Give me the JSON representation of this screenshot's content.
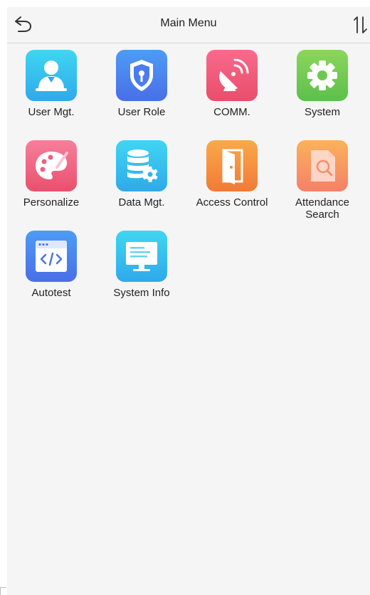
{
  "header": {
    "title": "Main Menu",
    "back_icon": "back-arrow-icon",
    "sort_icon": "sort-arrows-icon"
  },
  "menu": {
    "items": [
      {
        "id": "user-mgt",
        "label": "User Mgt.",
        "icon": "user-icon",
        "color_top": "#3fd6f2",
        "color_bottom": "#2fa9ea"
      },
      {
        "id": "user-role",
        "label": "User Role",
        "icon": "shield-key-icon",
        "color_top": "#4d9cf5",
        "color_bottom": "#4a6ee8"
      },
      {
        "id": "comm",
        "label": "COMM.",
        "icon": "satellite-dish-icon",
        "color_top": "#f86a8c",
        "color_bottom": "#ea4d6b"
      },
      {
        "id": "system",
        "label": "System",
        "icon": "gear-icon",
        "color_top": "#8bd65b",
        "color_bottom": "#5cc04c"
      },
      {
        "id": "personalize",
        "label": "Personalize",
        "icon": "palette-icon",
        "color_top": "#f77f9b",
        "color_bottom": "#e8506d"
      },
      {
        "id": "data-mgt",
        "label": "Data Mgt.",
        "icon": "database-gear-icon",
        "color_top": "#3fd6f2",
        "color_bottom": "#2fa9ea"
      },
      {
        "id": "access-control",
        "label": "Access Control",
        "icon": "door-icon",
        "color_top": "#f9a94a",
        "color_bottom": "#f27a36"
      },
      {
        "id": "attendance-search",
        "label_line1": "Attendance",
        "label_line2": "Search",
        "icon": "document-search-icon",
        "color_top": "#fbb25a",
        "color_bottom": "#f58068"
      },
      {
        "id": "autotest",
        "label": "Autotest",
        "icon": "code-window-icon",
        "color_top": "#4d9cf5",
        "color_bottom": "#4a6ee8"
      },
      {
        "id": "system-info",
        "label": "System Info",
        "icon": "monitor-icon",
        "color_top": "#3fd6f2",
        "color_bottom": "#2fa9ea"
      }
    ]
  }
}
